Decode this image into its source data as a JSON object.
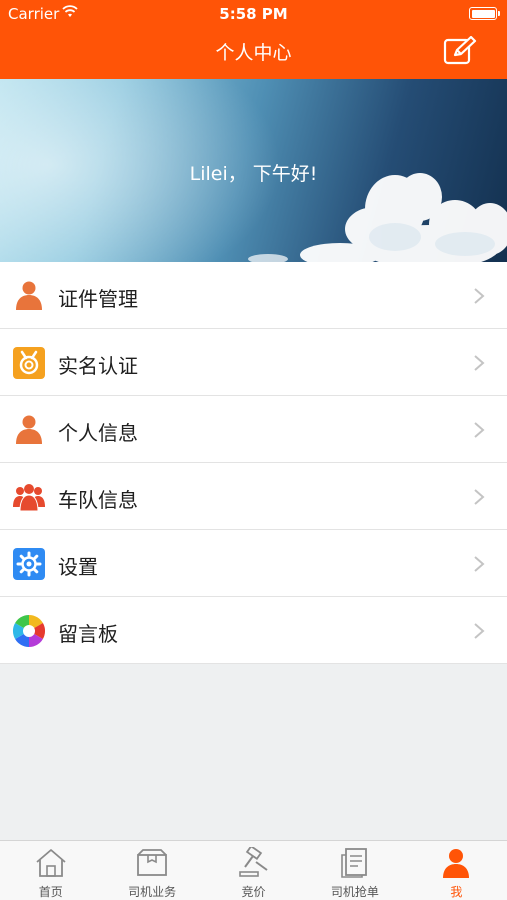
{
  "status_bar": {
    "carrier": "Carrier",
    "time": "5:58 PM"
  },
  "nav": {
    "title": "个人中心",
    "edit_icon": "edit-icon"
  },
  "banner": {
    "greeting": "Lilei，  下午好!"
  },
  "menu": {
    "items": [
      {
        "label": "证件管理",
        "icon": "person-icon",
        "color": "#e8743b"
      },
      {
        "label": "实名认证",
        "icon": "medal-icon",
        "color": "#f5a11f"
      },
      {
        "label": "个人信息",
        "icon": "person-icon",
        "color": "#e8743b"
      },
      {
        "label": "车队信息",
        "icon": "team-icon",
        "color": "#e64a2e"
      },
      {
        "label": "设置",
        "icon": "gear-icon",
        "color": "#2f8bf3"
      },
      {
        "label": "留言板",
        "icon": "aperture-icon",
        "color": "#2fb8e8"
      }
    ]
  },
  "tabbar": {
    "active_index": 4,
    "items": [
      {
        "label": "首页",
        "icon": "home-icon"
      },
      {
        "label": "司机业务",
        "icon": "box-icon"
      },
      {
        "label": "竞价",
        "icon": "gavel-icon"
      },
      {
        "label": "司机抢单",
        "icon": "document-icon"
      },
      {
        "label": "我",
        "icon": "user-icon"
      }
    ]
  },
  "colors": {
    "brand": "#ff5407",
    "background": "#eef0f1",
    "text": "#1f1f1f",
    "tab_inactive": "#555555"
  }
}
